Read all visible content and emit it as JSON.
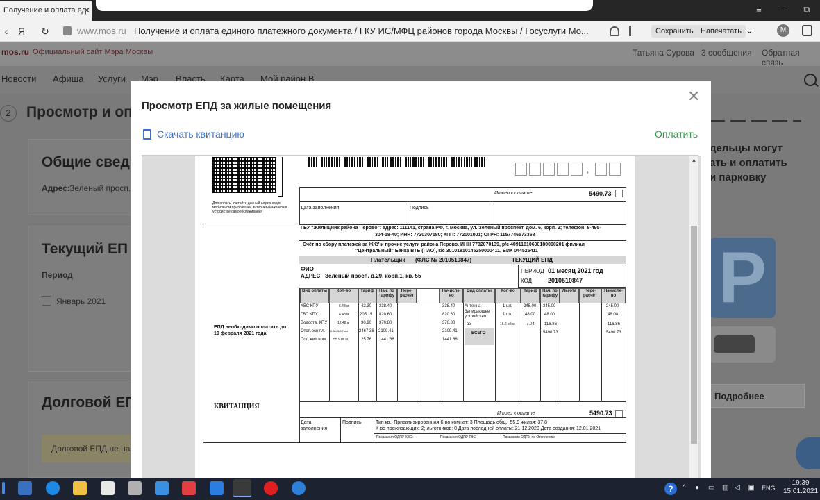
{
  "browser": {
    "tab_title": "Получение и оплата ед",
    "tab_close": "✕",
    "back": "‹",
    "yandex": "Я",
    "reload": "↻",
    "lock_icon": "🔒",
    "url_host": "www.mos.ru",
    "page_title": "Получение и оплата единого платёжного документа / ГКУ ИС/МФЦ районов города Москвы / Госуслуги Мо...",
    "save_label": "Сохранить",
    "print_label": "Напечатать",
    "avatar_letter": "M",
    "menu_icon": "≡",
    "minimize": "—",
    "restore": "⧉"
  },
  "site": {
    "logo": "mos.ru",
    "logo_sub": "Официальный сайт Мэра Москвы",
    "user_name": "Татьяна Сурова",
    "messages": "3 сообщения",
    "feedback": "Обратная связь",
    "nav": [
      "Новости",
      "Афиша",
      "Услуги",
      "Мэр",
      "Власть",
      "Карта",
      "Мой район В"
    ],
    "step_num": "2",
    "step_title": "Просмотр и опл",
    "card1_title": "Общие свед",
    "card1_addr_label": "Адрес:",
    "card1_addr": "Зеленый просп.",
    "card2_title": "Текущий ЕП",
    "card2_period_label": "Период",
    "card2_period_value": "Январь 2021",
    "card3_title": "Долговой ЕП",
    "card3_note": "Долговой ЕПД не на",
    "right_text": [
      "дельцы могут",
      "ать и оплатить",
      "и парковку"
    ],
    "parking_letter": "P",
    "more_button": "Подробнее"
  },
  "modal": {
    "title": "Просмотр ЕПД за жилые помещения",
    "close": "✕",
    "download": "Скачать квитанцию",
    "pay": "Оплатить"
  },
  "receipt": {
    "qr_caption": "Для оплаты считайте данный штрих-код в мобильном приложении интернет-банка или в устройстве самообслуживания",
    "total_label_top": "Итого к оплате",
    "total_value_top": "5490.73",
    "date_fill_label": "Дата заполнения",
    "signature_label": "Подпись",
    "gbu_line1": "ГБУ \"Жилищник района Перово\": адрес: 111141, страна РФ, г. Москва, ул. Зеленый проспект, дом. 6, корп. 2; телефон: 8-495-",
    "gbu_line2": "304-18-40; ИНН: 7720307180; КПП: 772001001; ОГРН: 1157746573368",
    "account_line1": "Счёт по сбору платежей за ЖКУ и прочие услуги района Перово. ИНН 7702070139, р/с 40911810600180000201 филиал",
    "account_line2": "\"Центральный\" Банка ВТБ (ПАО), к/с 30101810145250000411, БИК 044525411",
    "payer_label": "Плательщик",
    "fls": "(ФЛС № 2010510847)",
    "current_epd": "ТЕКУЩИЙ ЕПД",
    "fio_label": "ФИО",
    "address_label": "АДРЕС",
    "address_value": "Зеленый просп. д.29, корп.1, кв. 55",
    "period_label": "ПЕРИОД",
    "period_value": "01 месяц 2021 год",
    "code_label": "КОД",
    "code_value": "2010510847",
    "due_text": "ЕПД необходимо оплатить до 10 февраля 2021 года",
    "kvitancia": "КВИТАНЦИЯ",
    "left_headers": [
      "Вид оплаты",
      "Кол-во",
      "Тариф",
      "Нач. по тарифу",
      "Пере-расчёт",
      "Начисле-но"
    ],
    "right_headers": [
      "Вид оплаты",
      "Кол-во",
      "Тариф",
      "Нач. по тарифу",
      "Льгота",
      "Пере-расчёт",
      "Начисле-но"
    ],
    "left_rows": [
      [
        "ХВС КПУ",
        "6.48 м",
        "42.30",
        "338.40",
        "338.40"
      ],
      [
        "ГВС КПУ",
        "4.48 м",
        "205.15",
        "820.60",
        "820.60"
      ],
      [
        "Водоотв. КПУ",
        "12.48 м",
        "30.90",
        "370.80",
        "370.80"
      ],
      [
        "Отоп.осн.пл.",
        "0.8045/8 Гкал",
        "2467.38",
        "2109.41",
        "2109.41"
      ],
      [
        "Сод.жил.пом.",
        "55.9 кв.м.",
        "25.76",
        "1441.66",
        "1441.66"
      ]
    ],
    "right_rows": [
      [
        "Антенна",
        "1 шт.",
        "245.00",
        "245.00",
        "245.00"
      ],
      [
        "Запирающее устройство",
        "1 шт.",
        "48.00",
        "48.00",
        "48.00"
      ],
      [
        "Газ",
        "16.6 об.м",
        "7.04",
        "116.86",
        "116.86"
      ],
      [
        "ВСЕГО",
        "",
        "",
        "5490.73",
        "5490.73"
      ]
    ],
    "total_label_bottom": "Итого к оплате",
    "total_value_bottom": "5490.73",
    "bottom_date_label": "Дата заполнения",
    "bottom_sign_label": "Подпись",
    "info_line1": "Тип кв.: Приватизированная К-во комнат: 3 Площадь общ.: 55.9 жилая: 37.8",
    "info_line2": "К-во проживающих: 2; льготников: 0 Дата последней оплаты: 21.12.2020  Дата создания: 12.01.2021",
    "meters": [
      "Показания ОДПУ ХВС:",
      "Показания ОДПУ ГВС:",
      "Показания ОДПУ по Отоплению:"
    ]
  },
  "taskbar": {
    "lang": "ENG",
    "time": "19:39",
    "date": "15.01.2021"
  }
}
